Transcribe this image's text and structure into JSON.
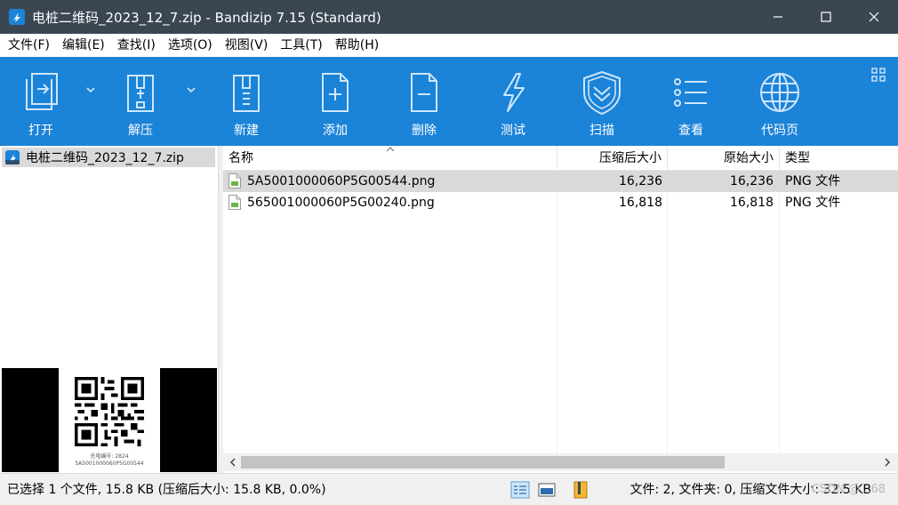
{
  "window": {
    "title": "电桩二维码_2023_12_7.zip - Bandizip 7.15 (Standard)"
  },
  "menu": [
    {
      "label": "文件(F)"
    },
    {
      "label": "编辑(E)"
    },
    {
      "label": "查找(I)"
    },
    {
      "label": "选项(O)"
    },
    {
      "label": "视图(V)"
    },
    {
      "label": "工具(T)"
    },
    {
      "label": "帮助(H)"
    }
  ],
  "toolbar": {
    "open": "打开",
    "extract": "解压",
    "new": "新建",
    "add": "添加",
    "delete": "删除",
    "test": "测试",
    "scan": "扫描",
    "view": "查看",
    "codepage": "代码页"
  },
  "tree": {
    "archive_name": "电桩二维码_2023_12_7.zip"
  },
  "preview": {
    "caption_line1": "充电编号: 2824",
    "caption_line2": "5A5001000060P5G00544"
  },
  "columns": {
    "name": "名称",
    "compressed": "压缩后大小",
    "original": "原始大小",
    "type": "类型"
  },
  "files": [
    {
      "name": "5A5001000060P5G00544.png",
      "compressed": "16,236",
      "original": "16,236",
      "type": "PNG 文件",
      "selected": true
    },
    {
      "name": "565001000060P5G00240.png",
      "compressed": "16,818",
      "original": "16,818",
      "type": "PNG 文件",
      "selected": false
    }
  ],
  "status": {
    "selection": "已选择 1 个文件, 15.8 KB (压缩后大小: 15.8 KB, 0.0%)",
    "summary": "文件: 2, 文件夹: 0, 压缩文件大小: 32.5 KB",
    "watermark": "CSDN @...68"
  },
  "colors": {
    "titlebar": "#3b4653",
    "toolbar": "#1b83d8",
    "selection": "#d9d9d9"
  }
}
